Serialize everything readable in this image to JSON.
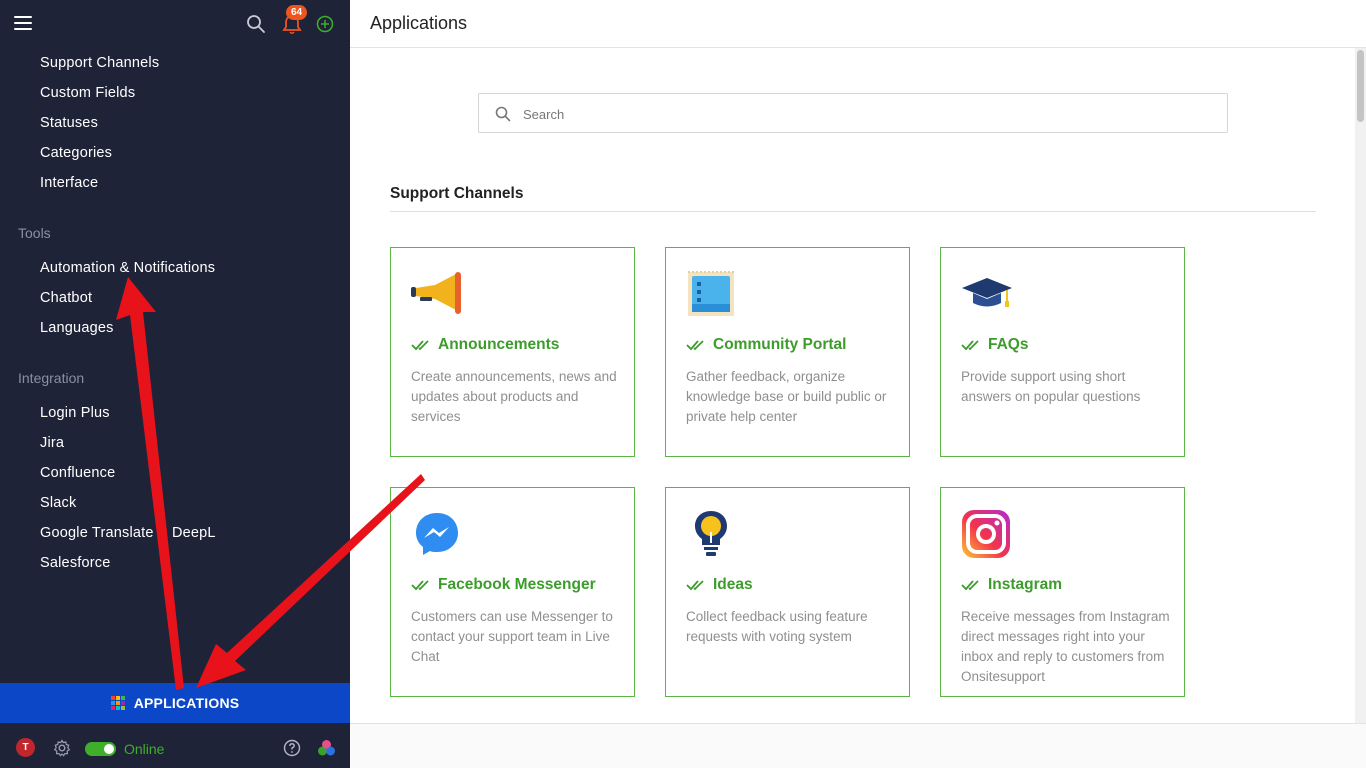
{
  "topbar": {
    "notification_count": "64"
  },
  "sidebar": {
    "items_group_1": [
      "Support Channels",
      "Custom Fields",
      "Statuses",
      "Categories",
      "Interface"
    ],
    "tools_heading": "Tools",
    "tools_items": [
      "Automation & Notifications",
      "Chatbot",
      "Languages"
    ],
    "integration_heading": "Integration",
    "integration_items": [
      "Login Plus",
      "Jira",
      "Confluence",
      "Slack",
      "Google Translate & DeepL",
      "Salesforce"
    ],
    "applications_label": "APPLICATIONS",
    "avatar_initial": "T",
    "status_label": "Online"
  },
  "main": {
    "title": "Applications",
    "search_placeholder": "Search",
    "section_title": "Support Channels",
    "cards": [
      {
        "title": "Announcements",
        "description": "Create announcements, news and updates about products and services",
        "icon": "megaphone-icon"
      },
      {
        "title": "Community Portal",
        "description": "Gather feedback, organize knowledge base or build public or private help center",
        "icon": "portal-icon"
      },
      {
        "title": "FAQs",
        "description": "Provide support using short answers on popular questions",
        "icon": "graduation-cap-icon"
      },
      {
        "title": "Facebook Messenger",
        "description": "Customers can use Messenger to contact your support team in Live Chat",
        "icon": "messenger-icon"
      },
      {
        "title": "Ideas",
        "description": "Collect feedback using feature requests with voting system",
        "icon": "lightbulb-icon"
      },
      {
        "title": "Instagram",
        "description": "Receive messages from Instagram direct messages right into your inbox and reply to customers from Onsitesupport",
        "icon": "instagram-icon"
      }
    ]
  },
  "colors": {
    "sidebar_bg": "#1f2338",
    "applications_bar": "#0c47c7",
    "card_border": "#5bb544",
    "card_title": "#3c9c2c",
    "badge": "#f0541e",
    "online": "#3fae2a",
    "annotation_arrow": "#e8121a"
  }
}
